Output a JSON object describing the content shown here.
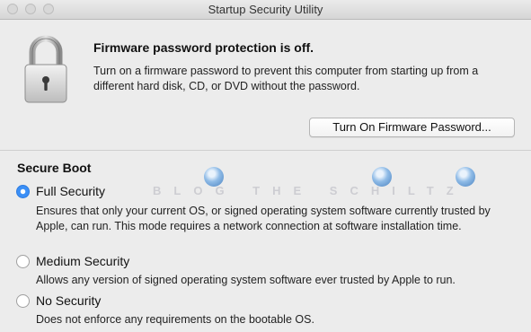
{
  "window": {
    "title": "Startup Security Utility"
  },
  "firmware": {
    "headline": "Firmware password protection is off.",
    "description": "Turn on a firmware password to prevent this computer from starting up from a different hard disk, CD, or DVD without the password.",
    "button_label": "Turn On Firmware Password..."
  },
  "secure_boot": {
    "title": "Secure Boot",
    "options": [
      {
        "label": "Full Security",
        "selected": true,
        "description": "Ensures that only your current OS, or signed operating system software currently trusted by Apple, can run. This mode requires a network connection at software installation time."
      },
      {
        "label": "Medium Security",
        "selected": false,
        "description": "Allows any version of signed operating system software ever trusted by Apple to run."
      },
      {
        "label": "No Security",
        "selected": false,
        "description": "Does not enforce any requirements on the bootable OS."
      }
    ]
  },
  "watermark": {
    "text": "BLOG THE SCHILTZ"
  },
  "colors": {
    "accent": "#3b8ff6",
    "background": "#ececec"
  }
}
